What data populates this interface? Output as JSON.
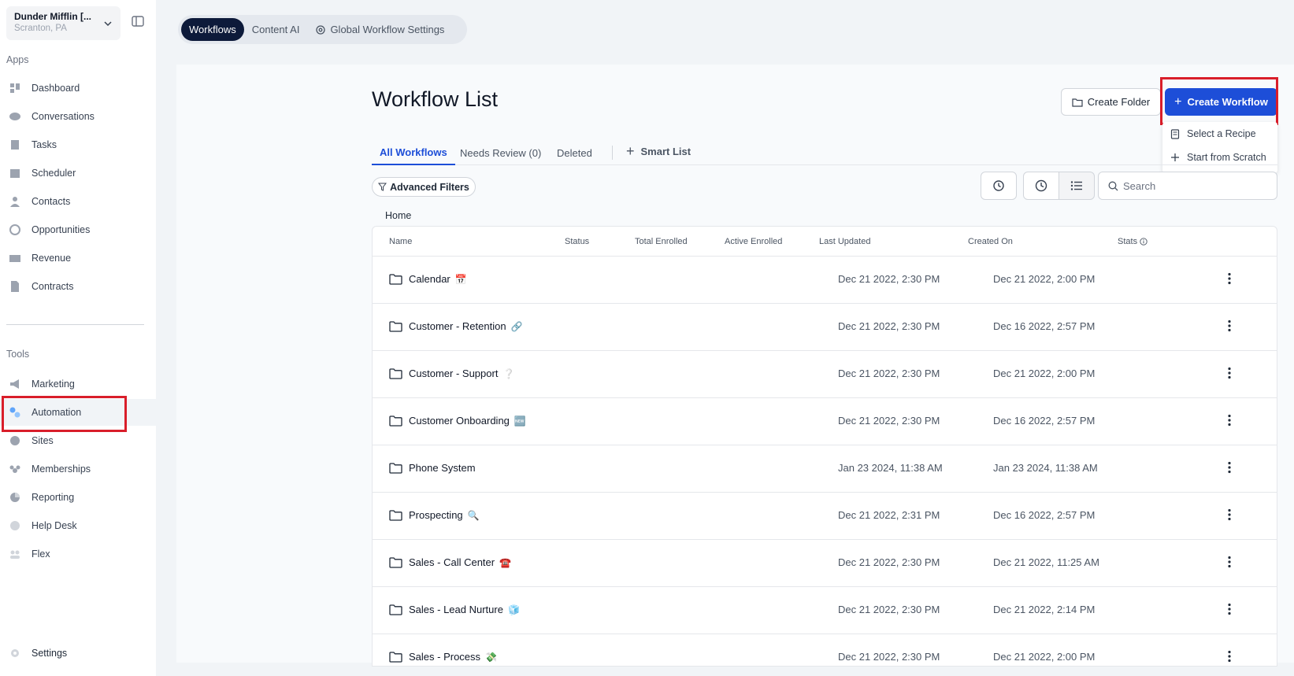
{
  "account": {
    "name": "Dunder Mifflin [...",
    "location": "Scranton, PA"
  },
  "sidebar": {
    "apps_label": "Apps",
    "apps": [
      {
        "label": "Dashboard",
        "icon": "dashboard-icon"
      },
      {
        "label": "Conversations",
        "icon": "chat-icon"
      },
      {
        "label": "Tasks",
        "icon": "task-icon"
      },
      {
        "label": "Scheduler",
        "icon": "calendar-icon"
      },
      {
        "label": "Contacts",
        "icon": "person-icon"
      },
      {
        "label": "Opportunities",
        "icon": "target-icon"
      },
      {
        "label": "Revenue",
        "icon": "card-icon"
      },
      {
        "label": "Contracts",
        "icon": "document-icon"
      }
    ],
    "tools_label": "Tools",
    "tools": [
      {
        "label": "Marketing",
        "icon": "megaphone-icon"
      },
      {
        "label": "Automation",
        "icon": "gears-icon"
      },
      {
        "label": "Sites",
        "icon": "globe-icon"
      },
      {
        "label": "Memberships",
        "icon": "group-icon"
      },
      {
        "label": "Reporting",
        "icon": "pie-chart-icon"
      },
      {
        "label": "Help Desk",
        "icon": "help-icon"
      },
      {
        "label": "Flex",
        "icon": "people-icon"
      }
    ],
    "active_item": "Automation",
    "settings_label": "Settings"
  },
  "top_tabs": [
    {
      "label": "Workflows",
      "active": true
    },
    {
      "label": "Content AI",
      "active": false
    },
    {
      "label": "Global Workflow Settings",
      "active": false
    }
  ],
  "page": {
    "title": "Workflow List",
    "create_folder_label": "Create Folder",
    "create_workflow_label": "Create Workflow",
    "create_menu": [
      "Select a Recipe",
      "Start from Scratch"
    ],
    "sub_tabs": [
      "All Workflows",
      "Needs Review (0)",
      "Deleted",
      "Smart List"
    ],
    "advanced_filters_label": "Advanced Filters",
    "search_placeholder": "Search",
    "breadcrumb": "Home"
  },
  "table": {
    "columns": [
      "Name",
      "Status",
      "Total Enrolled",
      "Active Enrolled",
      "Last Updated",
      "Created On",
      "Stats"
    ],
    "rows": [
      {
        "name": "Calendar",
        "emoji": "📅",
        "last_updated": "Dec 21 2022, 2:30 PM",
        "created_on": "Dec 21 2022, 2:00 PM"
      },
      {
        "name": "Customer - Retention",
        "emoji": "🔗",
        "last_updated": "Dec 21 2022, 2:30 PM",
        "created_on": "Dec 16 2022, 2:57 PM"
      },
      {
        "name": "Customer - Support",
        "emoji": "❔",
        "last_updated": "Dec 21 2022, 2:30 PM",
        "created_on": "Dec 21 2022, 2:00 PM"
      },
      {
        "name": "Customer Onboarding",
        "emoji": "🆕",
        "last_updated": "Dec 21 2022, 2:30 PM",
        "created_on": "Dec 16 2022, 2:57 PM"
      },
      {
        "name": "Phone System",
        "emoji": "",
        "last_updated": "Jan 23 2024, 11:38 AM",
        "created_on": "Jan 23 2024, 11:38 AM"
      },
      {
        "name": "Prospecting",
        "emoji": "🔍",
        "last_updated": "Dec 21 2022, 2:31 PM",
        "created_on": "Dec 16 2022, 2:57 PM"
      },
      {
        "name": "Sales - Call Center",
        "emoji": "☎️",
        "last_updated": "Dec 21 2022, 2:30 PM",
        "created_on": "Dec 21 2022, 11:25 AM"
      },
      {
        "name": "Sales - Lead Nurture",
        "emoji": "🧊",
        "last_updated": "Dec 21 2022, 2:30 PM",
        "created_on": "Dec 21 2022, 2:14 PM"
      },
      {
        "name": "Sales - Process",
        "emoji": "💸",
        "last_updated": "Dec 21 2022, 2:30 PM",
        "created_on": "Dec 21 2022, 2:00 PM"
      }
    ]
  },
  "colors": {
    "primary": "#1d4ed8",
    "highlight": "#d91e2a",
    "tab_active_bg": "#0d1a3a"
  }
}
